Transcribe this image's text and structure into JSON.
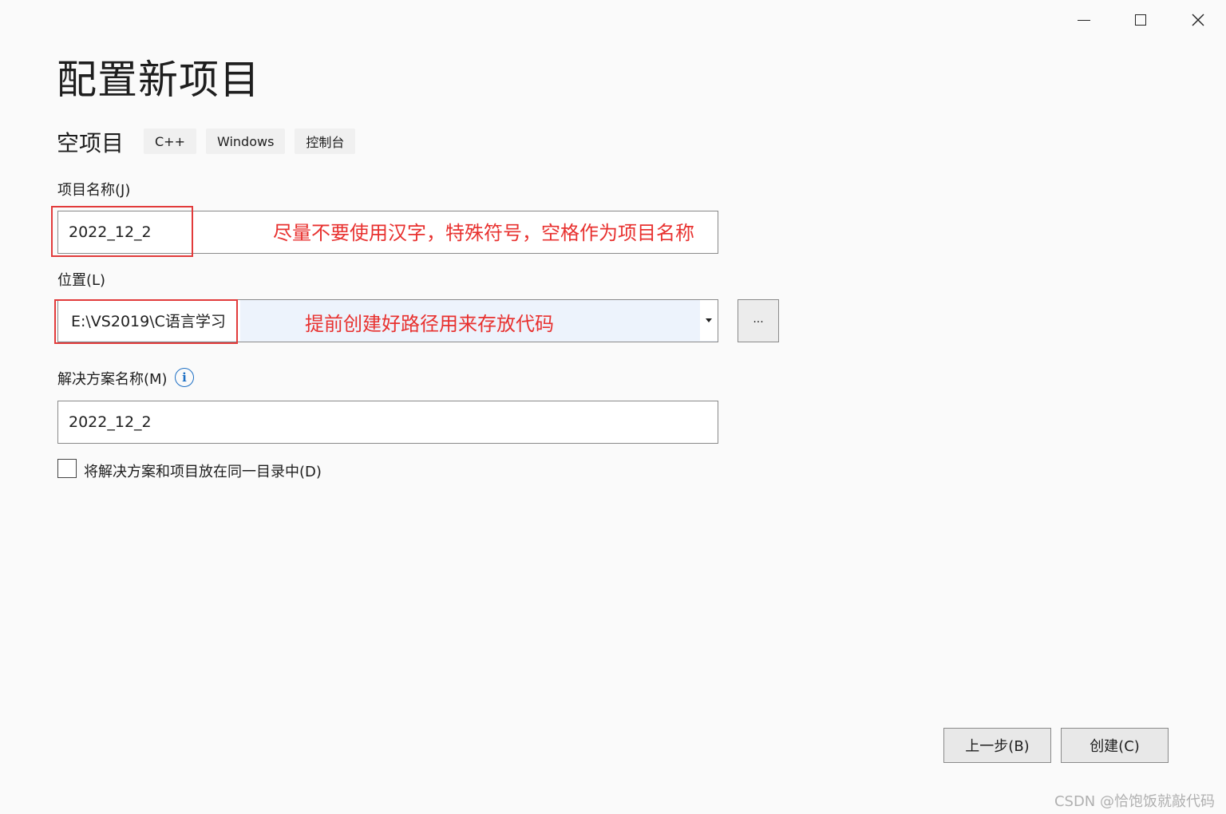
{
  "window": {
    "controls": {
      "minimize": "minimize",
      "maximize": "maximize",
      "close": "✕"
    }
  },
  "header": {
    "title": "配置新项目"
  },
  "template": {
    "name": "空项目",
    "tags": [
      "C++",
      "Windows",
      "控制台"
    ]
  },
  "form": {
    "project_name": {
      "label": "项目名称(J)",
      "value": "2022_12_2"
    },
    "location": {
      "label": "位置(L)",
      "value": "E:\\VS2019\\C语言学习",
      "browse_label": "..."
    },
    "solution_name": {
      "label": "解决方案名称(M)",
      "info_icon": "i",
      "value": "2022_12_2"
    },
    "same_directory": {
      "label": "将解决方案和项目放在同一目录中(D)",
      "checked": false
    }
  },
  "annotations": {
    "project_name_note": "尽量不要使用汉字，特殊符号，空格作为项目名称",
    "location_note": "提前创建好路径用来存放代码",
    "color": "#e8312f"
  },
  "footer": {
    "back_label": "上一步(B)",
    "create_label": "创建(C)"
  },
  "watermark": "CSDN @恰饱饭就敲代码"
}
